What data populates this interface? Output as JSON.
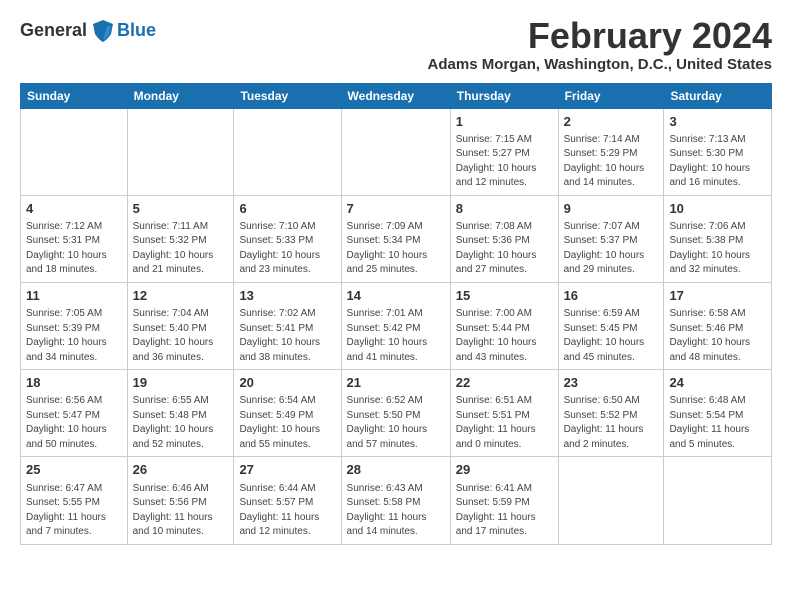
{
  "header": {
    "logo_general": "General",
    "logo_blue": "Blue",
    "title": "February 2024",
    "subtitle": "Adams Morgan, Washington, D.C., United States"
  },
  "weekdays": [
    "Sunday",
    "Monday",
    "Tuesday",
    "Wednesday",
    "Thursday",
    "Friday",
    "Saturday"
  ],
  "weeks": [
    [
      {
        "day": "",
        "info": ""
      },
      {
        "day": "",
        "info": ""
      },
      {
        "day": "",
        "info": ""
      },
      {
        "day": "",
        "info": ""
      },
      {
        "day": "1",
        "info": "Sunrise: 7:15 AM\nSunset: 5:27 PM\nDaylight: 10 hours\nand 12 minutes."
      },
      {
        "day": "2",
        "info": "Sunrise: 7:14 AM\nSunset: 5:29 PM\nDaylight: 10 hours\nand 14 minutes."
      },
      {
        "day": "3",
        "info": "Sunrise: 7:13 AM\nSunset: 5:30 PM\nDaylight: 10 hours\nand 16 minutes."
      }
    ],
    [
      {
        "day": "4",
        "info": "Sunrise: 7:12 AM\nSunset: 5:31 PM\nDaylight: 10 hours\nand 18 minutes."
      },
      {
        "day": "5",
        "info": "Sunrise: 7:11 AM\nSunset: 5:32 PM\nDaylight: 10 hours\nand 21 minutes."
      },
      {
        "day": "6",
        "info": "Sunrise: 7:10 AM\nSunset: 5:33 PM\nDaylight: 10 hours\nand 23 minutes."
      },
      {
        "day": "7",
        "info": "Sunrise: 7:09 AM\nSunset: 5:34 PM\nDaylight: 10 hours\nand 25 minutes."
      },
      {
        "day": "8",
        "info": "Sunrise: 7:08 AM\nSunset: 5:36 PM\nDaylight: 10 hours\nand 27 minutes."
      },
      {
        "day": "9",
        "info": "Sunrise: 7:07 AM\nSunset: 5:37 PM\nDaylight: 10 hours\nand 29 minutes."
      },
      {
        "day": "10",
        "info": "Sunrise: 7:06 AM\nSunset: 5:38 PM\nDaylight: 10 hours\nand 32 minutes."
      }
    ],
    [
      {
        "day": "11",
        "info": "Sunrise: 7:05 AM\nSunset: 5:39 PM\nDaylight: 10 hours\nand 34 minutes."
      },
      {
        "day": "12",
        "info": "Sunrise: 7:04 AM\nSunset: 5:40 PM\nDaylight: 10 hours\nand 36 minutes."
      },
      {
        "day": "13",
        "info": "Sunrise: 7:02 AM\nSunset: 5:41 PM\nDaylight: 10 hours\nand 38 minutes."
      },
      {
        "day": "14",
        "info": "Sunrise: 7:01 AM\nSunset: 5:42 PM\nDaylight: 10 hours\nand 41 minutes."
      },
      {
        "day": "15",
        "info": "Sunrise: 7:00 AM\nSunset: 5:44 PM\nDaylight: 10 hours\nand 43 minutes."
      },
      {
        "day": "16",
        "info": "Sunrise: 6:59 AM\nSunset: 5:45 PM\nDaylight: 10 hours\nand 45 minutes."
      },
      {
        "day": "17",
        "info": "Sunrise: 6:58 AM\nSunset: 5:46 PM\nDaylight: 10 hours\nand 48 minutes."
      }
    ],
    [
      {
        "day": "18",
        "info": "Sunrise: 6:56 AM\nSunset: 5:47 PM\nDaylight: 10 hours\nand 50 minutes."
      },
      {
        "day": "19",
        "info": "Sunrise: 6:55 AM\nSunset: 5:48 PM\nDaylight: 10 hours\nand 52 minutes."
      },
      {
        "day": "20",
        "info": "Sunrise: 6:54 AM\nSunset: 5:49 PM\nDaylight: 10 hours\nand 55 minutes."
      },
      {
        "day": "21",
        "info": "Sunrise: 6:52 AM\nSunset: 5:50 PM\nDaylight: 10 hours\nand 57 minutes."
      },
      {
        "day": "22",
        "info": "Sunrise: 6:51 AM\nSunset: 5:51 PM\nDaylight: 11 hours\nand 0 minutes."
      },
      {
        "day": "23",
        "info": "Sunrise: 6:50 AM\nSunset: 5:52 PM\nDaylight: 11 hours\nand 2 minutes."
      },
      {
        "day": "24",
        "info": "Sunrise: 6:48 AM\nSunset: 5:54 PM\nDaylight: 11 hours\nand 5 minutes."
      }
    ],
    [
      {
        "day": "25",
        "info": "Sunrise: 6:47 AM\nSunset: 5:55 PM\nDaylight: 11 hours\nand 7 minutes."
      },
      {
        "day": "26",
        "info": "Sunrise: 6:46 AM\nSunset: 5:56 PM\nDaylight: 11 hours\nand 10 minutes."
      },
      {
        "day": "27",
        "info": "Sunrise: 6:44 AM\nSunset: 5:57 PM\nDaylight: 11 hours\nand 12 minutes."
      },
      {
        "day": "28",
        "info": "Sunrise: 6:43 AM\nSunset: 5:58 PM\nDaylight: 11 hours\nand 14 minutes."
      },
      {
        "day": "29",
        "info": "Sunrise: 6:41 AM\nSunset: 5:59 PM\nDaylight: 11 hours\nand 17 minutes."
      },
      {
        "day": "",
        "info": ""
      },
      {
        "day": "",
        "info": ""
      }
    ]
  ]
}
